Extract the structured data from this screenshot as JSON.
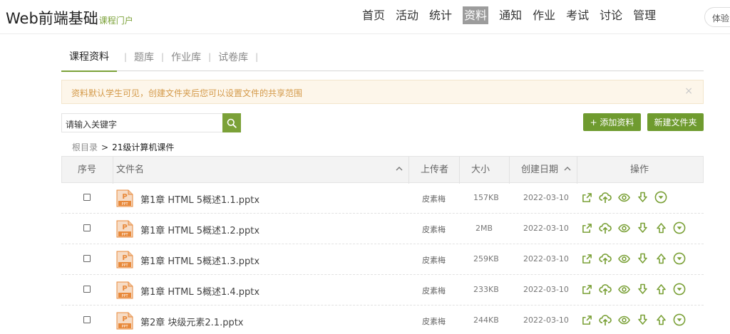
{
  "header": {
    "brand": "Web前端基础",
    "brand_sub": "课程门户",
    "nav": [
      "首页",
      "活动",
      "统计",
      "资料",
      "通知",
      "作业",
      "考试",
      "讨论",
      "管理"
    ],
    "active_nav": "资料",
    "experience_label": "体验"
  },
  "tabs": {
    "items": [
      "课程资料",
      "题库",
      "作业库",
      "试卷库"
    ],
    "active": "课程资料"
  },
  "notice": {
    "text": "资料默认学生可见，创建文件夹后您可以设置文件的共享范围",
    "close": "×"
  },
  "search": {
    "value": "请输入关键字"
  },
  "buttons": {
    "add": "+ 添加资料",
    "new_folder": "新建文件夹"
  },
  "breadcrumb": {
    "root": "根目录",
    "separator": ">",
    "current": "21级计算机课件"
  },
  "table": {
    "headers": {
      "index": "序号",
      "filename": "文件名",
      "uploader": "上传者",
      "size": "大小",
      "created": "创建日期",
      "actions": "操作"
    },
    "rows": [
      {
        "name": "第1章 HTML 5概述1.1.pptx",
        "uploader": "皮素梅",
        "size": "157KB",
        "date": "2022-03-10",
        "has_up": false
      },
      {
        "name": "第1章 HTML 5概述1.2.pptx",
        "uploader": "皮素梅",
        "size": "2MB",
        "date": "2022-03-10",
        "has_up": true
      },
      {
        "name": "第1章 HTML 5概述1.3.pptx",
        "uploader": "皮素梅",
        "size": "259KB",
        "date": "2022-03-10",
        "has_up": true
      },
      {
        "name": "第1章 HTML 5概述1.4.pptx",
        "uploader": "皮素梅",
        "size": "233KB",
        "date": "2022-03-10",
        "has_up": true
      },
      {
        "name": "第2章 块级元素2.1.pptx",
        "uploader": "皮素梅",
        "size": "244KB",
        "date": "2022-03-10",
        "has_up": true
      }
    ],
    "file_type_badge": "PPT"
  },
  "colors": {
    "accent": "#7ba138",
    "button": "#6f9b2f",
    "icon": "#7ba138",
    "ppt": "#e8893a"
  },
  "icons": {
    "search": "search-icon",
    "actions": [
      "open-external-icon",
      "cloud-upload-icon",
      "preview-eye-icon",
      "download-arrow-icon",
      "move-up-arrow-icon",
      "more-dropdown-icon"
    ]
  }
}
